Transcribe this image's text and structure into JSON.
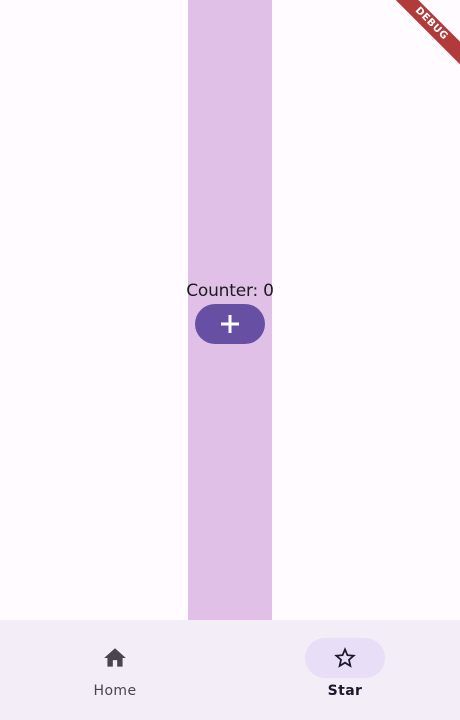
{
  "counter": {
    "label": "Counter: 0",
    "increment_icon": "plus-icon"
  },
  "nav": {
    "items": [
      {
        "label": "Home",
        "icon": "home-icon",
        "selected": false
      },
      {
        "label": "Star",
        "icon": "star-outline-icon",
        "selected": true
      }
    ]
  },
  "debug_banner": {
    "label": "DEBUG"
  },
  "colors": {
    "background": "#fffbfe",
    "column_strip": "#e0c0e6",
    "primary_button": "#6750a4",
    "nav_background": "#f3edf7",
    "nav_indicator": "#e8def8",
    "debug_banner": "#b13a3a"
  }
}
